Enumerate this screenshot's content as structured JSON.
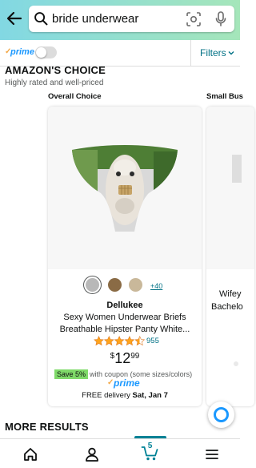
{
  "search": {
    "query": "bride underwear"
  },
  "filterbar": {
    "prime_check": "✓",
    "prime_label": "prime",
    "prime_toggle_on": false,
    "filters_label": "Filters"
  },
  "section": {
    "title": "AMAZON'S CHOICE",
    "subtitle": "Highly rated and well-priced",
    "column_labels": [
      "Overall Choice",
      "Small Bus"
    ]
  },
  "product": {
    "swatch_colors": [
      "#b8b8b8",
      "#8a6b45",
      "#c9b89a"
    ],
    "more_colors": "+40",
    "brand": "Dellukee",
    "title_line1": "Sexy Women Underwear Briefs",
    "title_line2": "Breathable Hipster Panty White...",
    "rating_stars": 4.5,
    "rating_count": "955",
    "price_currency": "$",
    "price_whole": "12",
    "price_fraction": "99",
    "coupon_badge": "Save 5%",
    "coupon_text": "with coupon (some sizes/colors)",
    "prime_check": "✓",
    "prime_label": "prime",
    "delivery_prefix": "FREE delivery",
    "delivery_date": "Sat, Jan 7"
  },
  "product2": {
    "title_line1": "Wifey",
    "title_line2": "Bachelo"
  },
  "more_results": "MORE RESULTS",
  "bottom_nav": {
    "cart_count": "5",
    "active_item": "cart"
  },
  "colors": {
    "header_gradient_start": "#82d8e3",
    "header_gradient_end": "#a5e6ba",
    "link": "#007185",
    "prime_blue": "#1a98ff",
    "star": "#ffa41c",
    "coupon_green": "#7fda69",
    "nav_active": "#008296"
  }
}
